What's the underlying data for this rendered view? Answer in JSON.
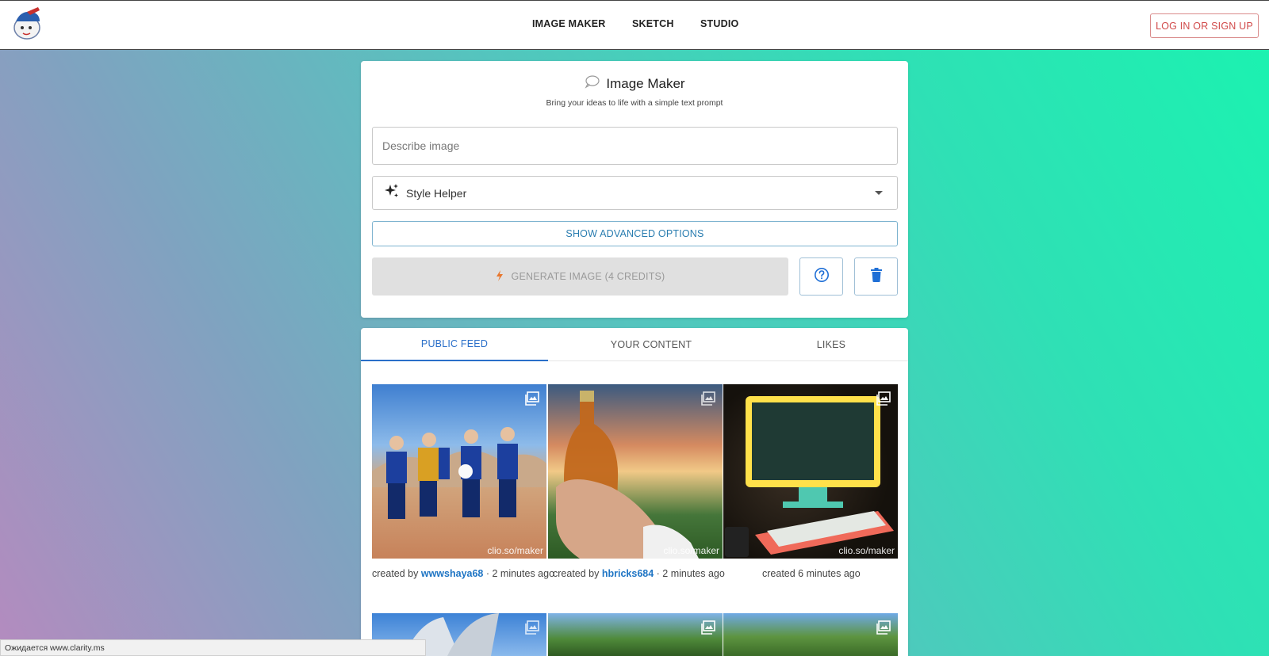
{
  "nav": {
    "items": [
      "IMAGE MAKER",
      "SKETCH",
      "STUDIO"
    ],
    "login_label": "LOG IN OR SIGN UP"
  },
  "maker": {
    "title": "Image Maker",
    "subtitle": "Bring your ideas to life with a simple text prompt",
    "describe_placeholder": "Describe image",
    "style_helper_label": "Style Helper",
    "advanced_label": "SHOW ADVANCED OPTIONS",
    "generate_label": "GENERATE IMAGE (4 CREDITS)"
  },
  "tabs": [
    "PUBLIC FEED",
    "YOUR CONTENT",
    "LIKES"
  ],
  "active_tab": "PUBLIC FEED",
  "feed": [
    {
      "created_prefix": "created by",
      "user": "wwwshaya68",
      "time": "· 2 minutes ago",
      "watermark": "clio.so/maker"
    },
    {
      "created_prefix": "created by",
      "user": "hbricks684",
      "time": "· 2 minutes ago",
      "watermark": "clio.so/maker"
    },
    {
      "created_prefix": "created 6 minutes ago",
      "user": "",
      "time": "",
      "watermark": "clio.so/maker"
    }
  ],
  "status_bar": "Ожидается www.clarity.ms",
  "colors": {
    "accent": "#2a6fc9",
    "login": "#d14a4a",
    "lightning": "#e8772e",
    "trash": "#1f6fd6"
  }
}
